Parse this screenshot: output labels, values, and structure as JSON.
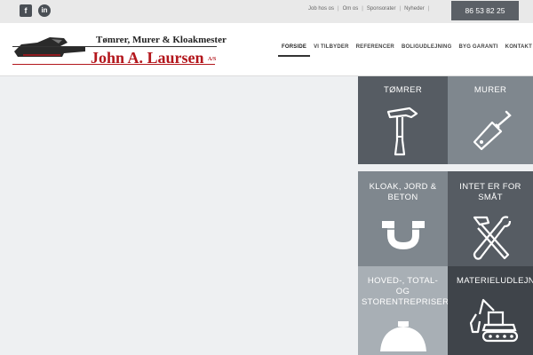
{
  "topbar": {
    "social": {
      "facebook": "f",
      "linkedin": "in"
    },
    "links": [
      "Job hos os",
      "Om os",
      "Sponsorater",
      "Nyheder"
    ],
    "separator": "|",
    "phone": "86 53 82 25"
  },
  "logo": {
    "line1": "Tømrer, Murer & Kloakmester",
    "line2": "John A. Laursen",
    "suffix": "A/S"
  },
  "nav": {
    "items": [
      "FORSIDE",
      "VI TILBYDER",
      "REFERENCER",
      "BOLIGUDLEJNING",
      "BYG GARANTI",
      "KONTAKT"
    ],
    "active": "FORSIDE"
  },
  "tiles": [
    {
      "label": "TØMRER",
      "icon": "hammer-icon",
      "color": "#565c63"
    },
    {
      "label": "MURER",
      "icon": "trowel-icon",
      "color": "#7f878e"
    },
    {
      "label": "KLOAK, JORD & BETON",
      "icon": "pipe-icon",
      "color": "#7f878e"
    },
    {
      "label": "INTET ER FOR SMÅT",
      "icon": "tools-icon",
      "color": "#565c63"
    },
    {
      "label": "HOVED-, TOTAL- OG STORENTREPRISER",
      "icon": "hardhat-icon",
      "color": "#a8afb5"
    },
    {
      "label": "MATERIELUDLEJNING",
      "icon": "excavator-icon",
      "color": "#3f444a"
    }
  ],
  "colors": {
    "hero_background": "#eef0f2",
    "accent_red": "#b3161c",
    "dark_tile": "#565c63"
  }
}
